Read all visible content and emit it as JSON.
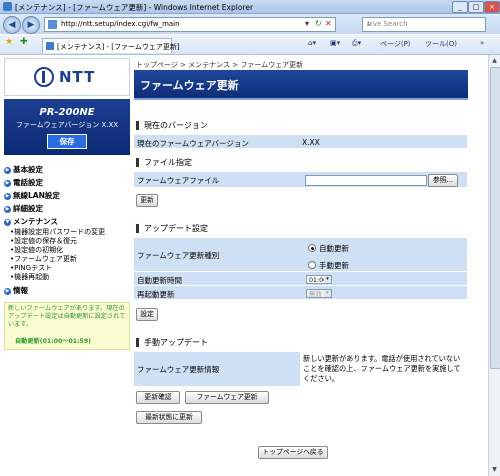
{
  "browser": {
    "window_title": "[メンテナンス] - [ファームウェア更新] - Windows Internet Explorer",
    "url": "http://ntt.setup/index.cgi/fw_main",
    "search_placeholder": "Live Search",
    "tab_title": "[メンテナンス] - [ファームウェア更新]",
    "toolbar_page": "ページ(P)",
    "toolbar_tools": "ツール(O)"
  },
  "left": {
    "brand": "NTT",
    "model": "PR-200NE",
    "firmware_version_label": "ファームウェアバージョン X.XX",
    "save_button": "保存",
    "menu": [
      {
        "label": "基本設定"
      },
      {
        "label": "電話設定"
      },
      {
        "label": "無線LAN設定"
      },
      {
        "label": "詳細設定"
      },
      {
        "label": "メンテナンス"
      },
      {
        "label": "情報"
      }
    ],
    "maintenance_items": [
      "機器設定用パスワードの変更",
      "設定値の保存＆復元",
      "設定値の初期化",
      "ファームウェア更新",
      "PINGテスト",
      "機器再起動"
    ],
    "notice_text": "新しいファームウェアがあります。現在のアップデート設定は自動更新に設定されています。",
    "notice_auto": "自動更新(01:00～01:59)"
  },
  "main": {
    "breadcrumb": "トップページ > メンテナンス > ファームウェア更新",
    "title": "ファームウェア更新",
    "current_version": {
      "heading": "現在のバージョン",
      "label": "現在のファームウェアバージョン",
      "value": "X.XX"
    },
    "file_spec": {
      "heading": "ファイル指定",
      "label": "ファームウェアファイル",
      "browse_button": "参照...",
      "update_button": "更新"
    },
    "update_settings": {
      "heading": "アップデート設定",
      "type_label": "ファームウェア更新種別",
      "auto_option": "自動更新",
      "manual_option": "手動更新",
      "time_label": "自動更新時間",
      "time_value": "01:00",
      "restart_label": "再起動更新",
      "restart_value": "無効",
      "set_button": "設定"
    },
    "manual_update": {
      "heading": "手動アップデート",
      "info_label": "ファームウェア更新情報",
      "info_text": "新しい更新があります。電話が使用されていないことを確認の上、ファームウェア更新を実施してください。",
      "confirm_button": "更新確認",
      "fw_update_button": "ファームウェア更新",
      "latest_button": "最新状態に更新"
    },
    "back_to_top_button": "トップページへ戻る"
  }
}
